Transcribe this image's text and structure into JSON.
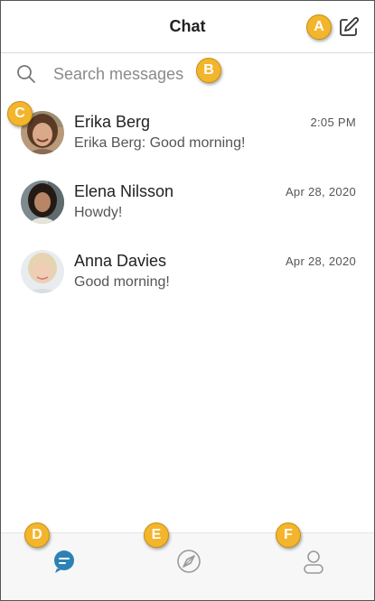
{
  "header": {
    "title": "Chat"
  },
  "search": {
    "placeholder": "Search messages"
  },
  "chats": [
    {
      "name": "Erika Berg",
      "time": "2:05 PM",
      "preview": "Erika Berg: Good morning!"
    },
    {
      "name": "Elena Nilsson",
      "time": "Apr 28, 2020",
      "preview": "Howdy!"
    },
    {
      "name": "Anna Davies",
      "time": "Apr 28, 2020",
      "preview": "Good morning!"
    }
  ],
  "tabs": [
    {
      "icon": "chat-bubble-icon",
      "active": true
    },
    {
      "icon": "discover-icon",
      "active": false
    },
    {
      "icon": "profile-icon",
      "active": false
    }
  ],
  "callouts": [
    "A",
    "B",
    "C",
    "D",
    "E",
    "F"
  ],
  "colors": {
    "accent": "#2d82b5",
    "callout": "#f3b52b",
    "inactive_icon": "#9a9a9a"
  }
}
